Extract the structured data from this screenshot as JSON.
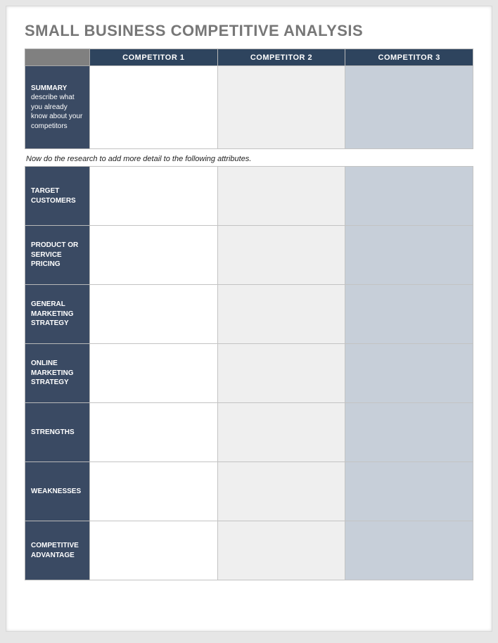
{
  "title": "SMALL BUSINESS COMPETITIVE ANALYSIS",
  "headers": {
    "c1": "COMPETITOR 1",
    "c2": "COMPETITOR 2",
    "c3": "COMPETITOR 3"
  },
  "summary": {
    "label_title": "SUMMARY",
    "label_sub": "describe what you already know about your competitors",
    "c1": "",
    "c2": "",
    "c3": ""
  },
  "instruction": "Now do the research to add more detail to the following attributes.",
  "rows": [
    {
      "label": "TARGET CUSTOMERS",
      "c1": "",
      "c2": "",
      "c3": ""
    },
    {
      "label": "PRODUCT OR SERVICE PRICING",
      "c1": "",
      "c2": "",
      "c3": ""
    },
    {
      "label": "GENERAL MARKETING STRATEGY",
      "c1": "",
      "c2": "",
      "c3": ""
    },
    {
      "label": "ONLINE MARKETING STRATEGY",
      "c1": "",
      "c2": "",
      "c3": ""
    },
    {
      "label": "STRENGTHS",
      "c1": "",
      "c2": "",
      "c3": ""
    },
    {
      "label": "WEAKNESSES",
      "c1": "",
      "c2": "",
      "c3": ""
    },
    {
      "label": "COMPETITIVE ADVANTAGE",
      "c1": "",
      "c2": "",
      "c3": ""
    }
  ]
}
